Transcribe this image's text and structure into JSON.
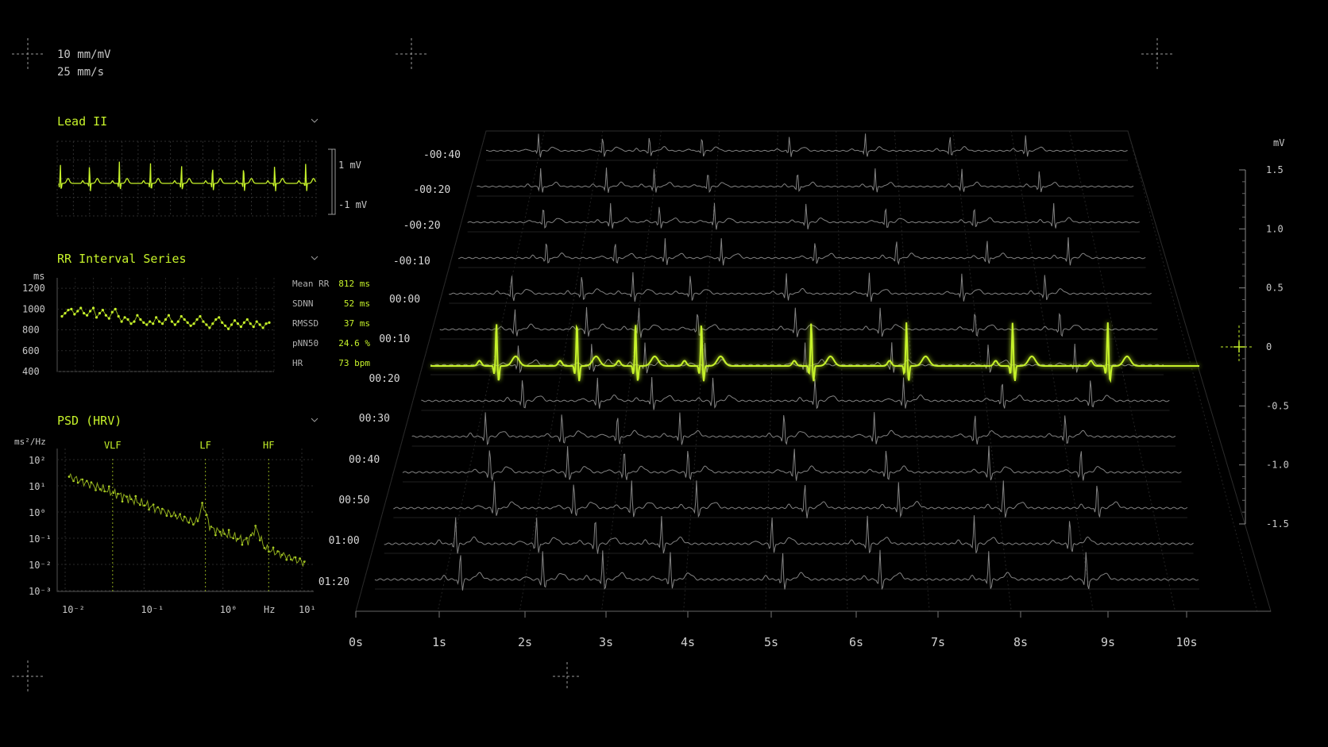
{
  "colors": {
    "accent": "#c6f22a",
    "accent_dim": "#8ca81c",
    "trace_grey": "#9a9a9a",
    "text": "#c8c8c8",
    "grid": "#3a3a3a",
    "background": "#000000"
  },
  "scale": {
    "gain": "10 mm/mV",
    "speed": "25 mm/s"
  },
  "lead_panel": {
    "title": "Lead II",
    "scale_top": "1 mV",
    "scale_bottom": "-1 mV",
    "expand_icon": "chevron-down-icon"
  },
  "rr_panel": {
    "title": "RR Interval Series",
    "unit": "ms",
    "y_ticks": [
      "1200",
      "1000",
      "800",
      "600",
      "400"
    ],
    "expand_icon": "chevron-down-icon",
    "stats": [
      {
        "label": "Mean RR",
        "value": "812 ms"
      },
      {
        "label": "SDNN",
        "value": "52 ms"
      },
      {
        "label": "RMSSD",
        "value": "37 ms"
      },
      {
        "label": "pNN50",
        "value": "24.6 %"
      },
      {
        "label": "HR",
        "value": "73 bpm"
      }
    ],
    "series_ms": [
      930,
      960,
      990,
      1000,
      950,
      980,
      1010,
      960,
      940,
      980,
      1010,
      920,
      960,
      990,
      940,
      910,
      970,
      1000,
      930,
      880,
      920,
      900,
      860,
      880,
      940,
      900,
      870,
      850,
      880,
      860,
      920,
      880,
      860,
      900,
      940,
      880,
      850,
      880,
      930,
      900,
      870,
      840,
      860,
      900,
      930,
      880,
      850,
      820,
      860,
      900,
      920,
      870,
      840,
      810,
      850,
      890,
      860,
      830,
      870,
      900,
      860,
      830,
      880,
      850,
      820,
      860,
      870
    ]
  },
  "psd_panel": {
    "title": "PSD (HRV)",
    "unit": "ms²/Hz",
    "expand_icon": "chevron-down-icon",
    "bands": [
      "VLF",
      "LF",
      "HF"
    ],
    "y_ticks": [
      "10²",
      "10¹",
      "10⁰",
      "10⁻¹",
      "10⁻²",
      "10⁻³"
    ],
    "x_ticks": [
      "10⁻²",
      "10⁻¹",
      "10⁰",
      "10¹"
    ],
    "x_unit": "Hz",
    "band_edges_hz": [
      0.04,
      0.6,
      3.8
    ]
  },
  "waterfall": {
    "time_labels": [
      "-00:40",
      "-00:20",
      "-00:20",
      "-00:10",
      "00:00",
      "00:10",
      "00:20",
      "00:30",
      "00:40",
      "00:50",
      "01:00",
      "01:20"
    ],
    "x_ticks": [
      "0s",
      "1s",
      "2s",
      "3s",
      "4s",
      "5s",
      "6s",
      "7s",
      "8s",
      "9s",
      "10s"
    ],
    "highlight_beats_s": [
      0.9,
      2.0,
      2.8,
      3.7,
      5.2,
      6.5,
      7.95,
      9.25
    ]
  },
  "mv_scale": {
    "unit": "mV",
    "ticks": [
      "1.5",
      "1.0",
      "0.5",
      "0",
      "-0.5",
      "-1.0",
      "-1.5"
    ]
  }
}
